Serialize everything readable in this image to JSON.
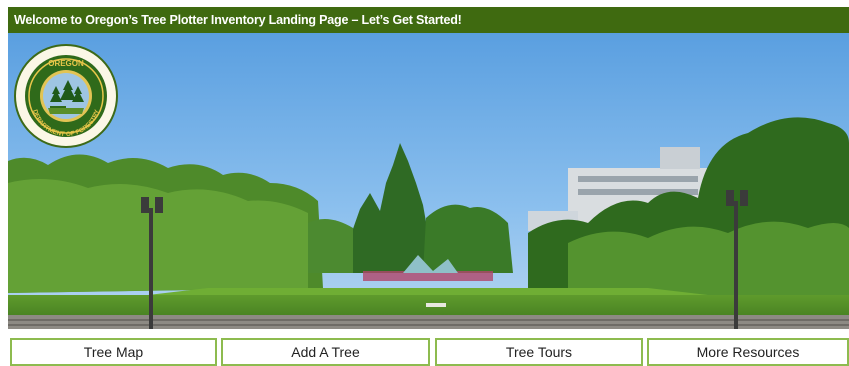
{
  "header": {
    "title": "Welcome to Oregon’s Tree Plotter Inventory Landing Page – Let’s Get Started!"
  },
  "logo": {
    "top_text": "OREGON",
    "bottom_text": "DEPARTMENT OF FORESTRY"
  },
  "nav": {
    "items": [
      {
        "label": "Tree Map"
      },
      {
        "label": "Add A Tree"
      },
      {
        "label": "Tree Tours"
      },
      {
        "label": "More Resources"
      }
    ]
  },
  "colors": {
    "header_bg": "#3f6a10",
    "button_border": "#8dbb4f",
    "logo_ring": "#3d6a18"
  }
}
